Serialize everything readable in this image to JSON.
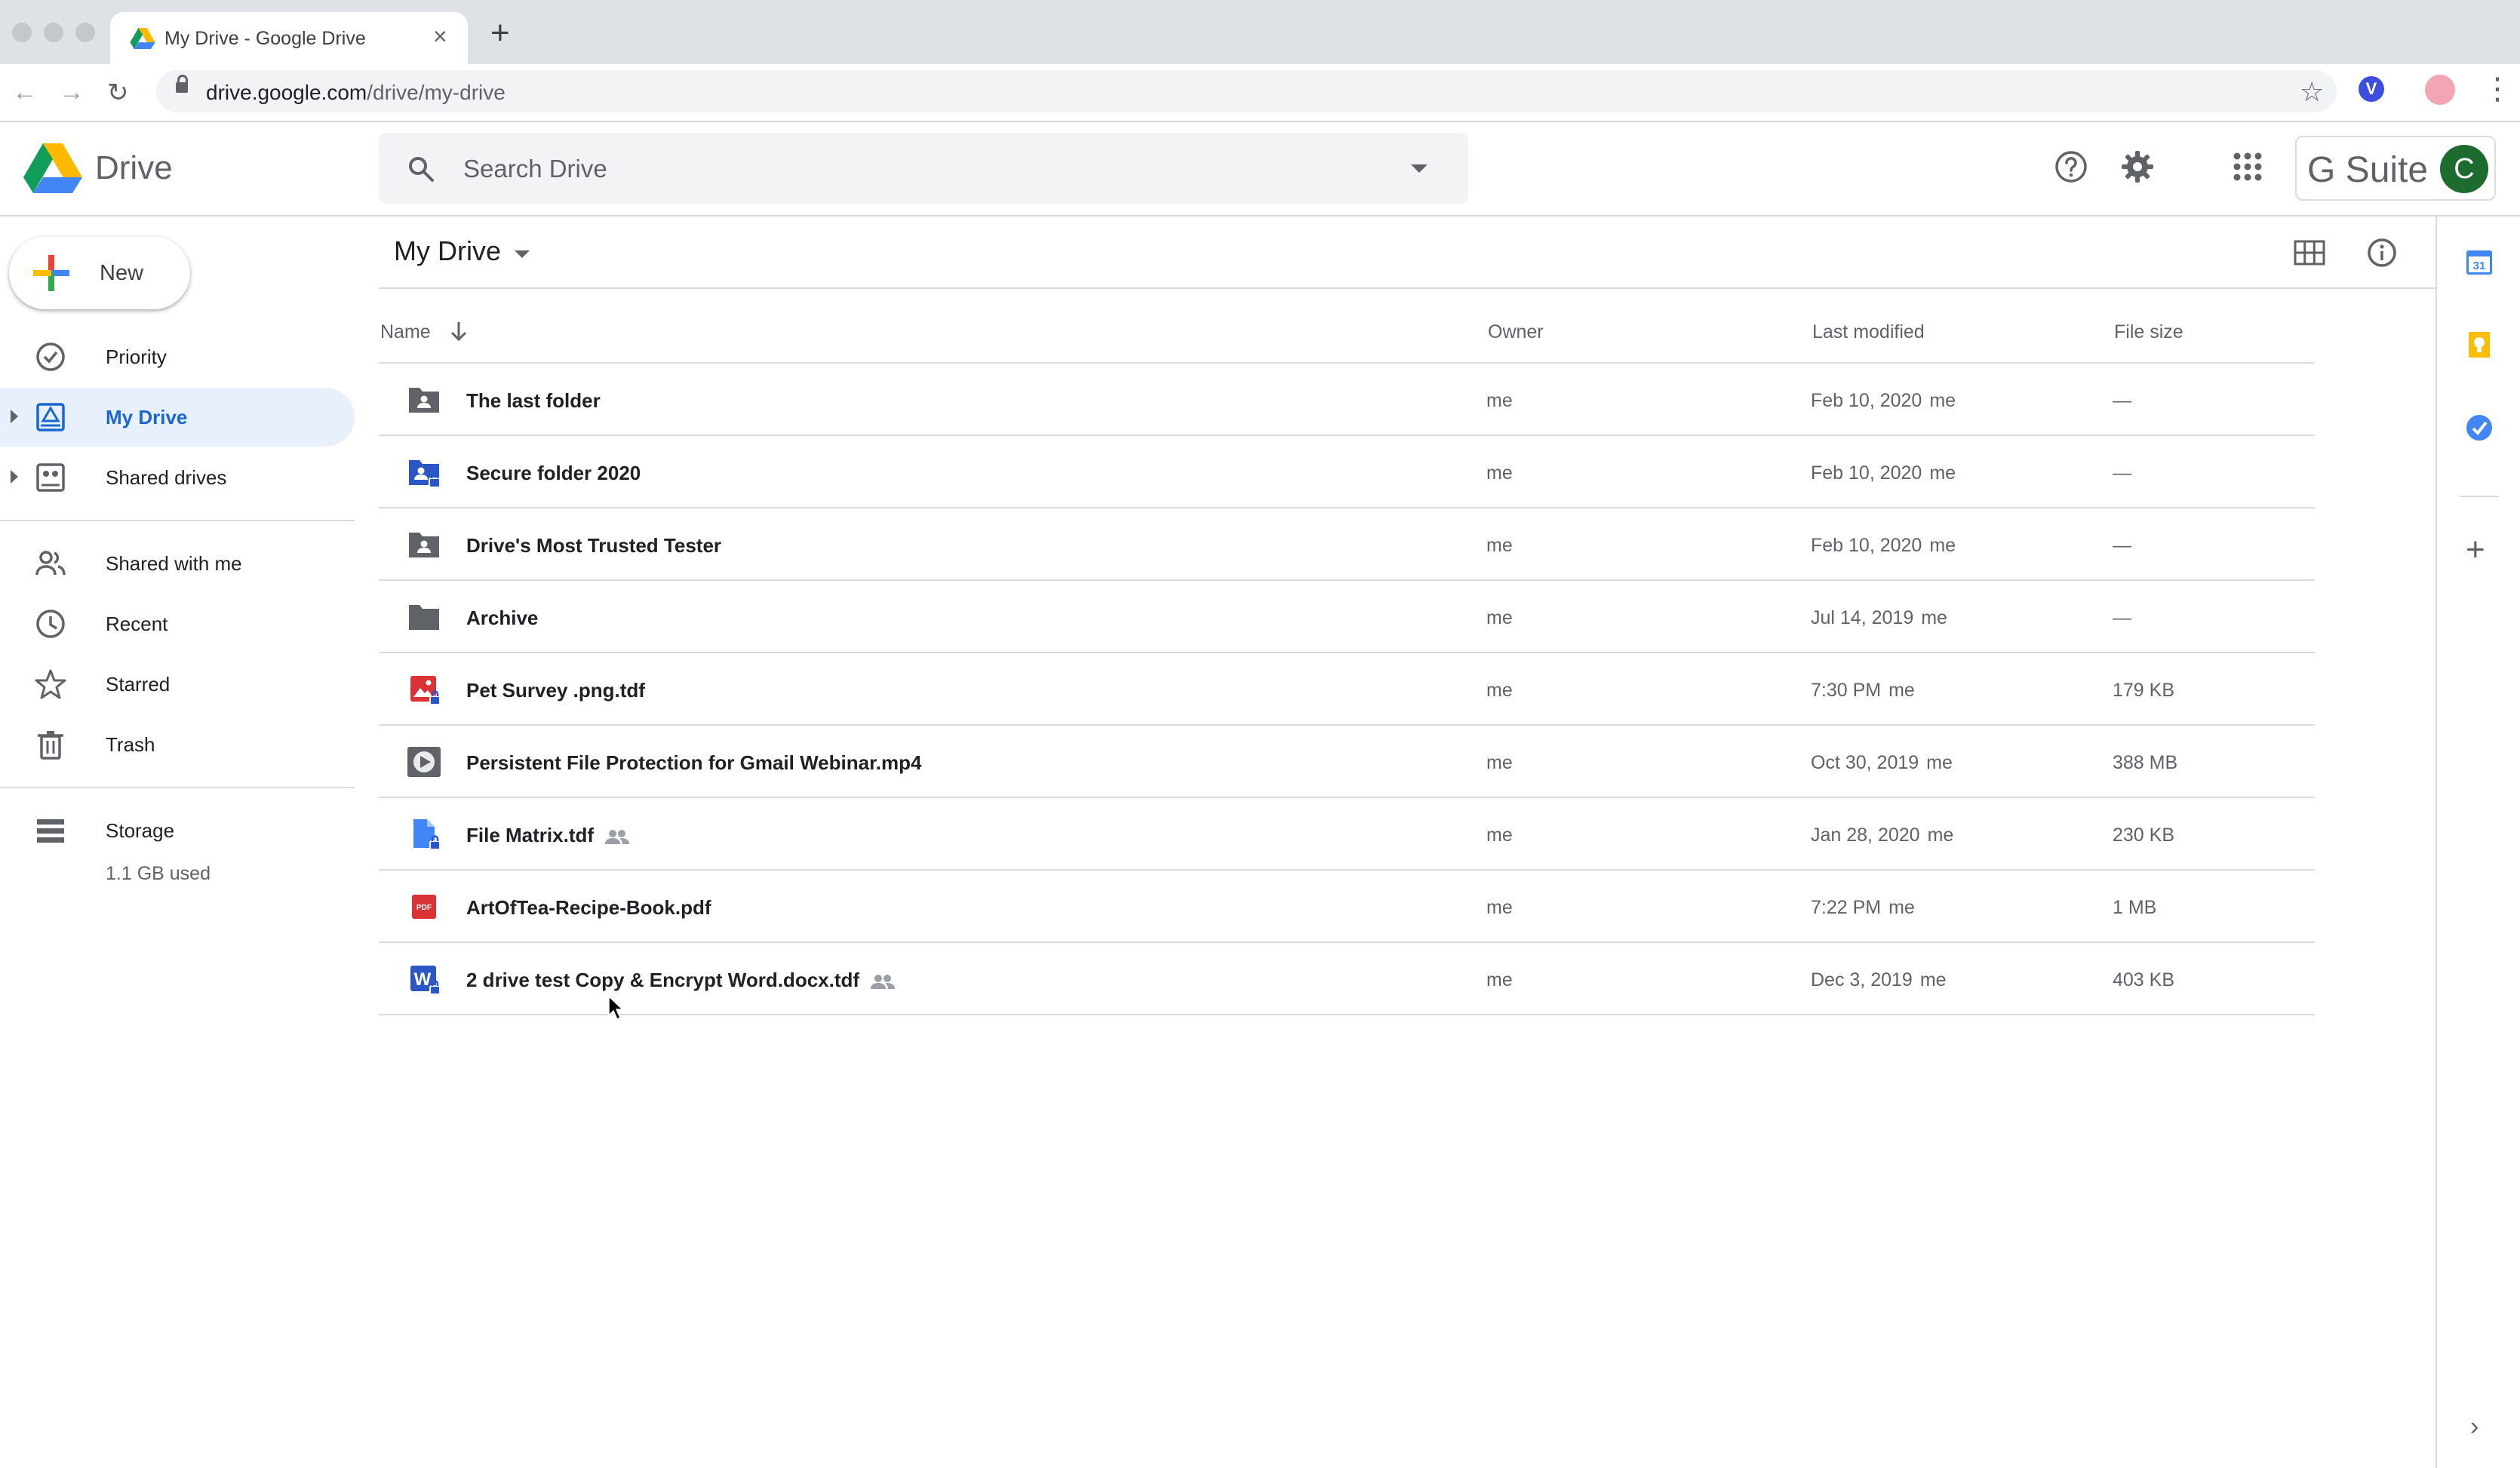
{
  "browser": {
    "tab_title": "My Drive - Google Drive",
    "url_host": "drive.google.com",
    "url_path": "/drive/my-drive",
    "icons": [
      "back-icon",
      "forward-icon",
      "reload-icon",
      "lock-icon",
      "bookmark-star-icon",
      "extension-icon",
      "profile-icon",
      "menu-icon"
    ]
  },
  "header": {
    "product_name": "Drive",
    "search_placeholder": "Search Drive",
    "gsuite_label": "G Suite",
    "avatar_initial": "C"
  },
  "sidebar": {
    "new_label": "New",
    "items": [
      {
        "label": "Priority",
        "icon": "priority-icon",
        "active": false
      },
      {
        "label": "My Drive",
        "icon": "my-drive-icon",
        "active": true
      },
      {
        "label": "Shared drives",
        "icon": "shared-drives-icon",
        "active": false
      },
      {
        "label": "Shared with me",
        "icon": "shared-with-me-icon",
        "active": false
      },
      {
        "label": "Recent",
        "icon": "recent-icon",
        "active": false
      },
      {
        "label": "Starred",
        "icon": "star-icon",
        "active": false
      },
      {
        "label": "Trash",
        "icon": "trash-icon",
        "active": false
      }
    ],
    "storage_label": "Storage",
    "storage_used": "1.1 GB used"
  },
  "main": {
    "location": "My Drive",
    "columns": {
      "name": "Name",
      "owner": "Owner",
      "modified": "Last modified",
      "size": "File size"
    },
    "files": [
      {
        "name": "The last folder",
        "type": "shared-folder",
        "shared": false,
        "owner": "me",
        "modified": "Feb 10, 2020",
        "modified_by": "me",
        "size": "—"
      },
      {
        "name": "Secure folder 2020",
        "type": "secure-shared-folder",
        "shared": false,
        "owner": "me",
        "modified": "Feb 10, 2020",
        "modified_by": "me",
        "size": "—"
      },
      {
        "name": "Drive's Most Trusted Tester",
        "type": "shared-folder",
        "shared": false,
        "owner": "me",
        "modified": "Feb 10, 2020",
        "modified_by": "me",
        "size": "—"
      },
      {
        "name": "Archive",
        "type": "folder",
        "shared": false,
        "owner": "me",
        "modified": "Jul 14, 2019",
        "modified_by": "me",
        "size": "—"
      },
      {
        "name": "Pet Survey .png.tdf",
        "type": "secure-image",
        "shared": false,
        "owner": "me",
        "modified": "7:30 PM",
        "modified_by": "me",
        "size": "179 KB"
      },
      {
        "name": "Persistent File Protection for Gmail Webinar.mp4",
        "type": "video",
        "shared": false,
        "owner": "me",
        "modified": "Oct 30, 2019",
        "modified_by": "me",
        "size": "388 MB"
      },
      {
        "name": "File Matrix.tdf",
        "type": "secure-doc",
        "shared": true,
        "owner": "me",
        "modified": "Jan 28, 2020",
        "modified_by": "me",
        "size": "230 KB"
      },
      {
        "name": "ArtOfTea-Recipe-Book.pdf",
        "type": "pdf",
        "shared": false,
        "owner": "me",
        "modified": "7:22 PM",
        "modified_by": "me",
        "size": "1 MB"
      },
      {
        "name": "2 drive test Copy & Encrypt Word.docx.tdf",
        "type": "secure-word",
        "shared": true,
        "owner": "me",
        "modified": "Dec 3, 2019",
        "modified_by": "me",
        "size": "403 KB"
      }
    ]
  },
  "side_panel": {
    "calendar_day": "31",
    "icons": [
      "calendar-icon",
      "keep-icon",
      "tasks-icon",
      "add-addon-icon",
      "expand-panel-icon"
    ]
  },
  "colors": {
    "accent_blue": "#1967d2",
    "active_bg": "#e8f0fe",
    "folder_gray": "#5f6368",
    "secure_blue": "#2a56c6",
    "pdf_red": "#db3236",
    "avatar_green": "#1e6b2f"
  }
}
